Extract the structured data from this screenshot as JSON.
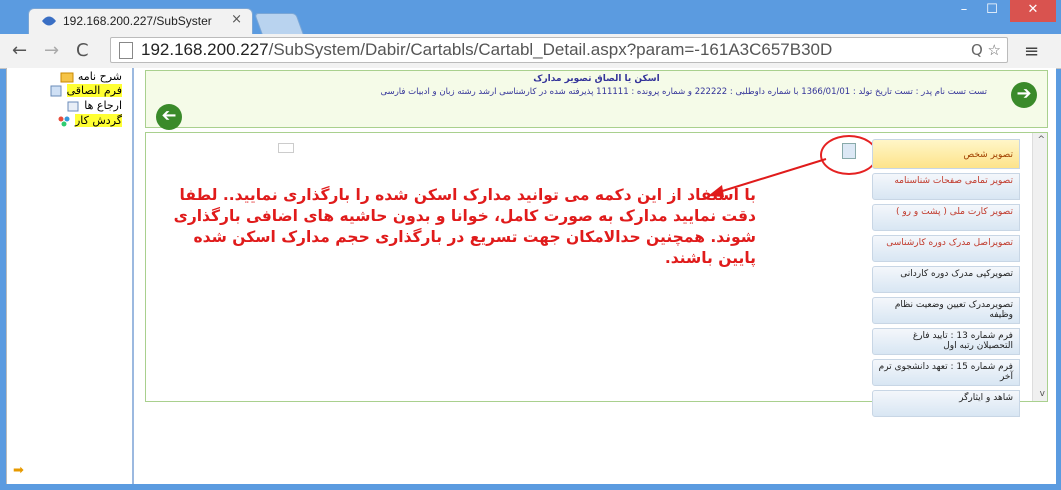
{
  "browser": {
    "tab_title": "192.168.200.227/SubSyster",
    "tab_close": "×",
    "url_host": "192.168.200.227",
    "url_path": "/SubSystem/Dabir/Cartabls/Cartabl_Detail.aspx?param=-161A3C657B30D",
    "win_min": "–",
    "win_max": "☐",
    "win_close": "✕",
    "back_icon": "←",
    "fwd_icon": "→",
    "reload_icon": "C",
    "omni_tools": "Q ☆",
    "menu_icon": "≡"
  },
  "left_panel": {
    "items": [
      {
        "label": "شرح نامه",
        "highlight": false
      },
      {
        "label": "فرم الصاقی",
        "highlight": true
      },
      {
        "label": "ارجاع ها",
        "highlight": false
      },
      {
        "label": "گردش کار",
        "highlight": true
      }
    ],
    "collapse_icon": "➡"
  },
  "header": {
    "title": "اسکن یا الصاق تصویر مدارک",
    "info": "تست تست نام پدر : تست تاریخ تولد : 1366/01/01 با شماره داوطلبی : 222222 و شماره پرونده : 111111 پذیرفته شده در کارشناسی  ارشد رشته زبان و ادبیات فارسی",
    "next_icon": "➔",
    "back_icon": "➔"
  },
  "content": {
    "menu_items": [
      {
        "label": "تصویر شخص",
        "style": "active"
      },
      {
        "label": "تصویر تمامی صفحات شناسنامه",
        "style": "warn"
      },
      {
        "label": "تصویر کارت ملی ( پشت و رو )",
        "style": "warn"
      },
      {
        "label": "تصویراصل مدرک دوره کارشناسی",
        "style": "warn"
      },
      {
        "label": "تصویرکپی مدرک دوره کاردانی",
        "style": "normal"
      },
      {
        "label": "تصویرمدرک تعیین وضعیت نظام وظیفه",
        "style": "normal"
      },
      {
        "label": "فرم شماره 13 : تایید فارغ التحصیلان رتبه اول",
        "style": "normal"
      },
      {
        "label": "فرم شماره 15 : تعهد دانشجوی ترم آخر",
        "style": "normal"
      },
      {
        "label": "شاهد و ایثارگر",
        "style": "normal"
      }
    ],
    "annotation": "با استفاد از این دکمه می توانید مدارک اسکن شده را بارگذاری نمایید.. لطفا دقت نمایید مدارک به صورت کامل، خوانا و بدون حاشیه های اضافی بارگذاری شوند. همچنین حدالامکان جهت تسریع در بارگذاری حجم مدارک اسکن شده پایین باشند.",
    "scroll_up": "^",
    "scroll_down": "v"
  },
  "colors": {
    "annotation": "#e01b1b",
    "header_text": "#333399",
    "go_button": "#3a8a2a",
    "highlight": "#ffff33"
  }
}
